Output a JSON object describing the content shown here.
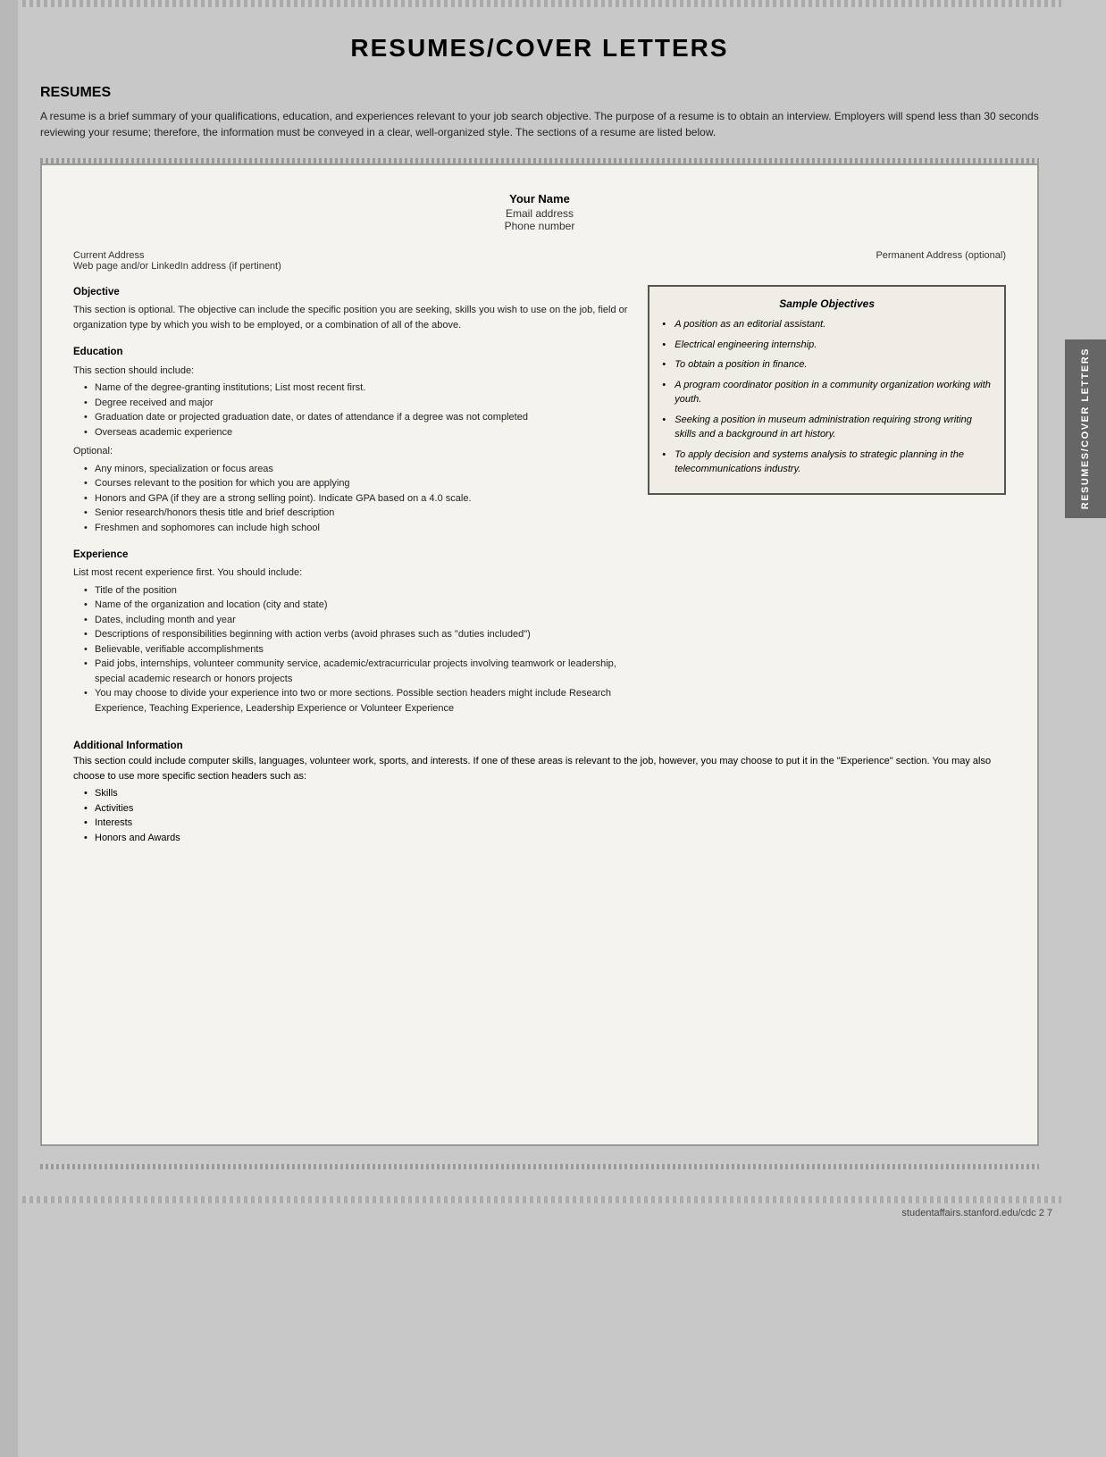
{
  "page": {
    "title": "RESUMES/COVER LETTERS",
    "footer": "studentaffairs.stanford.edu/cdc    2 7"
  },
  "resumes_section": {
    "heading": "RESUMES",
    "intro": "A resume is a brief summary of your qualifications, education, and experiences relevant to your job search objective. The purpose of a resume is to obtain an interview. Employers will spend less than 30 seconds reviewing your resume; therefore, the information must be conveyed in a clear, well-organized style. The sections of a resume are listed below."
  },
  "resume_doc": {
    "header": {
      "name": "Your Name",
      "email": "Email address",
      "phone": "Phone number"
    },
    "address_left": "Current Address\nWeb page and/or LinkedIn address (if pertinent)",
    "address_right": "Permanent Address (optional)",
    "objective": {
      "title": "Objective",
      "text": "This section is optional. The objective can include the specific position you are seeking, skills you wish to use on the job, field or organization type by which you wish to be employed, or a combination of all of the above."
    },
    "education": {
      "title": "Education",
      "intro": "This section should include:",
      "items": [
        "Name of the degree-granting institutions; List most recent first.",
        "Degree received and major",
        "Graduation date or projected graduation date, or dates of attendance if a degree was not completed",
        "Overseas academic experience"
      ],
      "optional_label": "Optional:",
      "optional_items": [
        "Any minors, specialization or focus areas",
        "Courses relevant to the position for which you are applying",
        "Honors and GPA (if they are a strong selling point). Indicate GPA based on a 4.0 scale.",
        "Senior research/honors thesis title and brief description",
        "Freshmen and sophomores can include high school"
      ]
    },
    "experience": {
      "title": "Experience",
      "intro": "List most recent experience first. You should include:",
      "items": [
        "Title of the position",
        "Name of the organization and location (city and state)",
        "Dates, including month and year",
        "Descriptions of responsibilities beginning with action verbs (avoid phrases such as \"duties included\")",
        "Believable, verifiable accomplishments",
        "Paid jobs, internships, volunteer community service, academic/extracurricular projects involving teamwork or leadership, special academic research or honors projects",
        "You may choose to divide your experience into two or more sections. Possible section headers might include Research Experience, Teaching Experience, Leadership Experience or Volunteer Experience"
      ]
    },
    "additional_info": {
      "title": "Additional Information",
      "text": "This section could include computer skills, languages, volunteer work, sports, and interests. If one of these areas is relevant to the job, however, you may choose to put it in the \"Experience\" section. You may also choose to use more specific section headers such as:",
      "items": [
        "Skills",
        "Activities",
        "Interests",
        "Honors and Awards"
      ]
    }
  },
  "sample_objectives": {
    "title": "Sample Objectives",
    "items": [
      "A position as an editorial assistant.",
      "Electrical engineering internship.",
      "To obtain a position in finance.",
      "A program coordinator position in a community organization working with youth.",
      "Seeking a position in museum administration requiring strong writing skills and a background in art history.",
      "To apply decision and systems analysis to strategic planning in the telecommunications industry."
    ]
  },
  "side_tab": {
    "text": "RESUMES/COVER LETTERS"
  }
}
